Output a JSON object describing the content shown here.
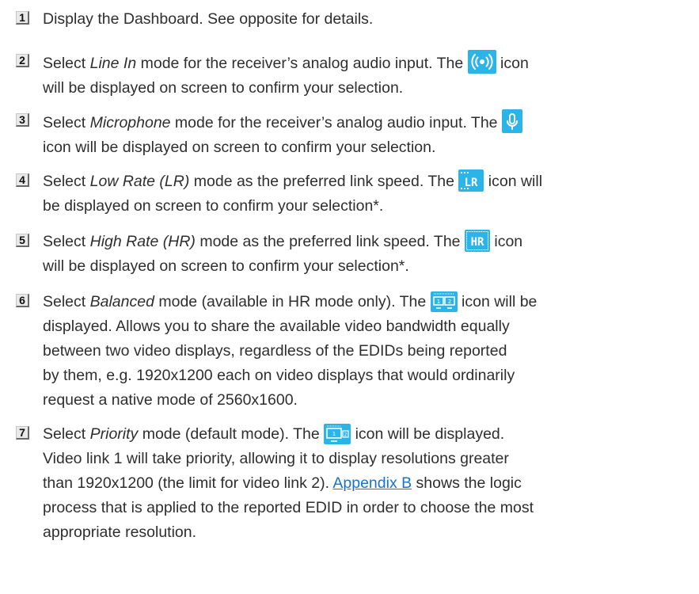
{
  "items": [
    {
      "number": "1",
      "lines": [
        "Display the Dashboard. See opposite for details."
      ]
    },
    {
      "number": "2",
      "line1_before": "Select ",
      "line1_em": "Line In",
      "line1_mid": " mode for the receiver’s analog audio input. The ",
      "line1_after": " icon",
      "line2": "will be displayed on screen to confirm your selection.",
      "icon": "line-in-icon"
    },
    {
      "number": "3",
      "line1_before": "Select ",
      "line1_em": "Microphone",
      "line1_mid": " mode for the receiver’s analog audio input. The ",
      "line2": "icon will be displayed on screen to confirm your selection.",
      "icon": "microphone-icon"
    },
    {
      "number": "4",
      "line1_before": "Select ",
      "line1_em": "Low Rate (LR)",
      "line1_mid": " mode as the preferred link speed. The ",
      "line1_after": " icon will",
      "line2": "be displayed on screen to confirm your selection*.",
      "icon": "low-rate-icon",
      "icon_text": "LR"
    },
    {
      "number": "5",
      "line1_before": "Select ",
      "line1_em": "High Rate (HR)",
      "line1_mid": " mode as the preferred link speed. The ",
      "line1_after": " icon",
      "line2": "will be displayed on screen to confirm your selection*.",
      "icon": "high-rate-icon",
      "icon_text": "HR"
    },
    {
      "number": "6",
      "line1_before": "Select ",
      "line1_em": "Balanced",
      "line1_mid": " mode (available in HR mode only). The ",
      "line1_after": " icon will be",
      "lines": [
        "displayed. Allows you to share the available video bandwidth equally",
        "between two video displays, regardless of the EDIDs being reported",
        "by them, e.g. 1920x1200 each on video displays that would ordinarily",
        "request a native mode of 2560x1600."
      ],
      "icon": "balanced-icon"
    },
    {
      "number": "7",
      "line1_before": "Select ",
      "line1_em": "Priority",
      "line1_mid": " mode (default mode). The ",
      "line1_after": " icon will be displayed.",
      "line2": "Video link 1 will take priority, allowing it to display resolutions greater",
      "line3_before": "than 1920x1200 (the limit for video link 2). ",
      "line3_link": "Appendix B",
      "line3_after": " shows the logic",
      "line4": "process that is applied to the reported EDID in order to choose the most",
      "line5": "appropriate resolution.",
      "icon": "priority-icon"
    }
  ],
  "colors": {
    "icon_blue": "#2bb4e8",
    "link": "#1a73c9"
  }
}
